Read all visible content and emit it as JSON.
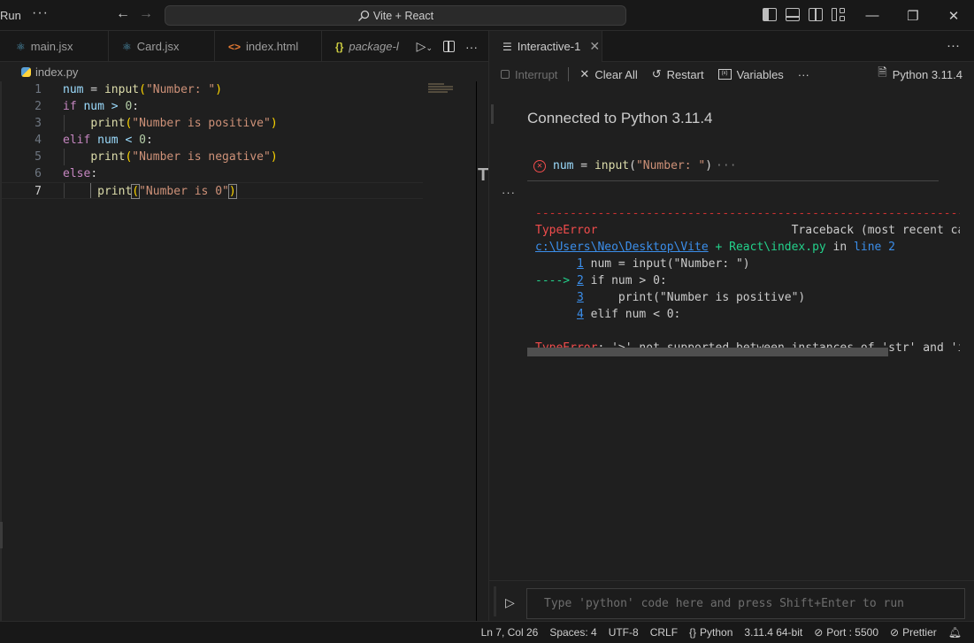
{
  "titlebar": {
    "menu_run": "Run",
    "more": "···",
    "back": "←",
    "forward": "→",
    "command_center": "Vite + React",
    "minimize": "—",
    "restore": "❐",
    "close": "✕"
  },
  "editor_tabs": [
    {
      "label": "main.jsx",
      "icon": "react-icon"
    },
    {
      "label": "Card.jsx",
      "icon": "react-icon"
    },
    {
      "label": "index.html",
      "icon": "html-icon"
    },
    {
      "label": "package-l",
      "icon": "json-icon"
    }
  ],
  "breadcrumb": {
    "file": "index.py"
  },
  "code_lines": [
    {
      "n": "1"
    },
    {
      "n": "2"
    },
    {
      "n": "3"
    },
    {
      "n": "4"
    },
    {
      "n": "5"
    },
    {
      "n": "6"
    },
    {
      "n": "7"
    }
  ],
  "code": {
    "l1": {
      "a": "num",
      "b": " = ",
      "c": "input",
      "d": "(",
      "e": "\"Number: \"",
      "f": ")"
    },
    "l2": {
      "a": "if",
      "b": " num > ",
      "c": "0",
      "d": ":"
    },
    "l3": {
      "a": "print",
      "b": "(",
      "c": "\"Number is positive\"",
      "d": ")"
    },
    "l4": {
      "a": "elif",
      "b": " num < ",
      "c": "0",
      "d": ":"
    },
    "l5": {
      "a": "print",
      "b": "(",
      "c": "\"Number is negative\"",
      "d": ")"
    },
    "l6": {
      "a": "else",
      "b": ":"
    },
    "l7": {
      "a": "print",
      "b": "(",
      "c": "\"Number is 0\"",
      "d": ")"
    }
  },
  "interactive": {
    "tab_label": "Interactive-1",
    "toolbar": {
      "interrupt": "Interrupt",
      "clear_all": "Clear All",
      "restart": "Restart",
      "variables": "Variables",
      "more": "···",
      "kernel": "Python 3.11.4"
    },
    "connected": "Connected to Python 3.11.4",
    "cell_code": {
      "a": "num",
      "b": " = ",
      "c": "input",
      "d": "(",
      "e": "\"Number: \"",
      "f": ")",
      "ellipsis": "···"
    },
    "output": {
      "dashes": "---------------------------------------------------------------------------",
      "error_name": "TypeError",
      "traceback_label": "                            Traceback (most recent call last)",
      "path_link": "c:\\Users\\Neo\\Desktop\\Vite",
      "path_rest": " + React\\index.py",
      "in_word": " in ",
      "line_ref": "line 2",
      "tb_lines": [
        {
          "prefix": "      ",
          "num": "1",
          "code": " num = input(\"Number: \")"
        },
        {
          "prefix": "----> ",
          "num": "2",
          "code": " if num > 0:"
        },
        {
          "prefix": "      ",
          "num": "3",
          "code": "     print(\"Number is positive\")"
        },
        {
          "prefix": "      ",
          "num": "4",
          "code": " elif num < 0:"
        }
      ],
      "final_error_name": "TypeError",
      "final_message": ": '>' not supported between instances of 'str' and 'int'"
    },
    "input_placeholder": "Type 'python' code here and press Shift+Enter to run"
  },
  "statusbar": {
    "position": "Ln 7, Col 26",
    "spaces": "Spaces: 4",
    "encoding": "UTF-8",
    "eol": "CRLF",
    "language": "Python",
    "interpreter": "3.11.4 64-bit",
    "port": "Port : 5500",
    "prettier": "Prettier"
  },
  "colors": {
    "keyword": "#c586c0",
    "function": "#dcdcaa",
    "string": "#ce9178",
    "number": "#b5cea8",
    "error": "#f14c4c",
    "link": "#3b8eea",
    "green": "#23d18b"
  }
}
